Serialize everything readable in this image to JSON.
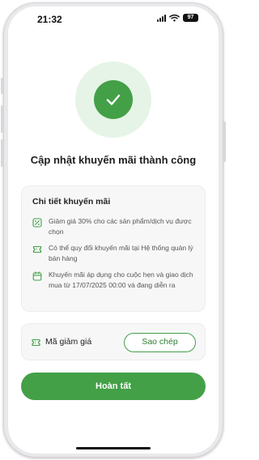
{
  "status_bar": {
    "time": "21:32",
    "battery": "97",
    "signal_icon": "signal-icon",
    "wifi_icon": "wifi-icon",
    "battery_icon": "battery-icon"
  },
  "success": {
    "icon": "check-icon",
    "title": "Cập nhật khuyến mãi thành công"
  },
  "details": {
    "heading": "Chi tiết khuyến mãi",
    "items": [
      {
        "icon": "percent-tag-icon",
        "text": "Giảm giá 30% cho các sản phẩm/dịch vụ được chọn"
      },
      {
        "icon": "ticket-icon",
        "text": "Có thể quy đổi khuyến mãi tại Hệ thống quản lý bán hàng"
      },
      {
        "icon": "calendar-icon",
        "text": "Khuyến mãi áp dụng cho cuộc hẹn và giao dịch mua từ 17/07/2025 00:00 và đang diễn ra"
      }
    ]
  },
  "coupon": {
    "icon": "ticket-icon",
    "label": "Mã giảm giá",
    "copy_label": "Sao chép"
  },
  "actions": {
    "done_label": "Hoàn tất"
  },
  "colors": {
    "accent": "#43a047",
    "accent_light": "#e5f4e6",
    "card_bg": "#f7f7f8"
  }
}
